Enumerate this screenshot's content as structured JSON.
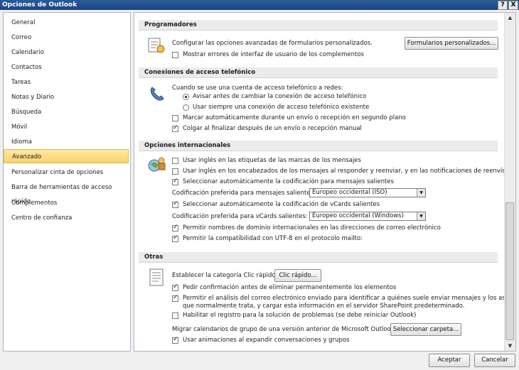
{
  "window": {
    "title": "Opciones de Outlook",
    "help_glyph": "?",
    "close_glyph": "X"
  },
  "sidebar": {
    "items": [
      {
        "label": "General"
      },
      {
        "label": "Correo"
      },
      {
        "label": "Calendario"
      },
      {
        "label": "Contactos"
      },
      {
        "label": "Tareas"
      },
      {
        "label": "Notas y Diario"
      },
      {
        "label": "Búsqueda"
      },
      {
        "label": "Móvil"
      },
      {
        "label": "Idioma"
      },
      {
        "label": "Avanzado"
      },
      {
        "label": "Personalizar cinta de opciones"
      },
      {
        "label": "Barra de herramientas de acceso rápido"
      },
      {
        "label": "Complementos"
      },
      {
        "label": "Centro de confianza"
      }
    ],
    "active": "Avanzado"
  },
  "sections": {
    "programadores": {
      "title": "Programadores",
      "config_text": "Configurar las opciones avanzadas de formularios personalizados.",
      "forms_button": "Formularios personalizados...",
      "show_errors": {
        "label": "Mostrar errores de interfaz de usuario de los complementos",
        "checked": false
      }
    },
    "conexiones": {
      "title": "Conexiones de acceso telefónico",
      "when_text": "Cuando se use una cuenta de acceso telefónico a redes:",
      "radio_warn": {
        "label": "Avisar antes de cambiar la conexión de acceso telefónico",
        "selected": true
      },
      "radio_always": {
        "label": "Usar siempre una conexión de acceso telefónico existente",
        "selected": false
      },
      "auto_dial": {
        "label": "Marcar automáticamente durante un envío o recepción en segundo plano",
        "checked": false
      },
      "hang_up": {
        "label": "Colgar al finalizar después de un envío o recepción manual",
        "checked": true
      }
    },
    "internacionales": {
      "title": "Opciones internacionales",
      "english_flags": {
        "label": "Usar inglés en las etiquetas de las marcas de los mensajes",
        "checked": false
      },
      "english_headers": {
        "label": "Usar inglés en los encabezados de los mensajes al responder y reenviar, y en las notificaciones de reenvío.",
        "checked": false
      },
      "auto_encoding": {
        "label": "Seleccionar automáticamente la codificación para mensajes salientes",
        "checked": true
      },
      "encoding_label": "Codificación preferida para mensajes salientes:",
      "encoding_value": "Europeo occidental (ISO)",
      "auto_vcard": {
        "label": "Seleccionar automáticamente la codificación de vCards salientes",
        "checked": true
      },
      "vcard_label": "Codificación preferida para vCards salientes:",
      "vcard_value": "Europeo occidental (Windows)",
      "intl_domains": {
        "label": "Permitir nombres de dominio internacionales en las direcciones de correo electrónico",
        "checked": true
      },
      "utf8": {
        "label": "Permitir la compatibilidad con UTF-8 en el protocolo mailto:",
        "checked": true
      }
    },
    "otras": {
      "title": "Otras",
      "quick_click_label": "Establecer la categoría Clic rápido:",
      "quick_click_button": "Clic rápido...",
      "confirm_delete": {
        "label": "Pedir confirmación antes de eliminar permanentemente los elementos",
        "checked": true
      },
      "analysis_line1": "Permitir el análisis del correo electrónico enviado para identificar a quiénes suele enviar mensajes y los asuntos",
      "analysis_line2": "que normalmente trata, y cargar esta información en el servidor SharePoint predeterminado.",
      "analysis_checked": true,
      "troubleshoot": {
        "label": "Habilitar el registro para la solución de problemas (se debe reiniciar Outlook)",
        "checked": false
      },
      "migrate_label": "Migrar calendarios de grupo de una versión anterior de Microsoft Outlook:",
      "migrate_button": "Seleccionar carpeta...",
      "animations": {
        "label": "Usar animaciones al expandir conversaciones y grupos",
        "checked": true
      }
    }
  },
  "footer": {
    "accept": "Aceptar",
    "cancel": "Cancelar"
  }
}
